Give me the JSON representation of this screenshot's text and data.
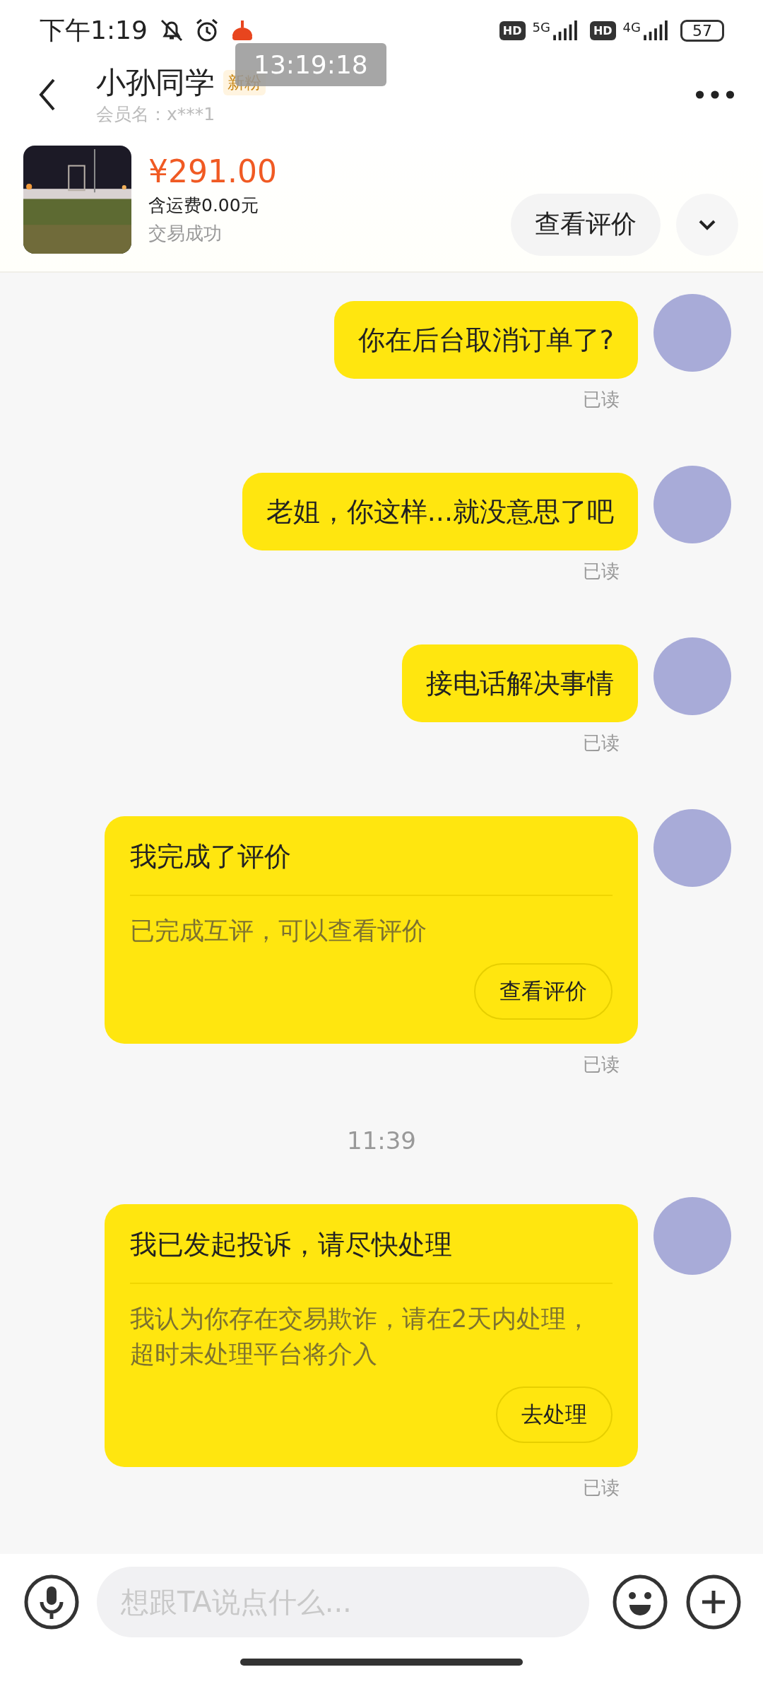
{
  "status_bar": {
    "time": "下午1:19",
    "networks": [
      {
        "hd": "HD",
        "type": "5G"
      },
      {
        "hd": "HD",
        "type": "4G"
      }
    ],
    "battery": "57"
  },
  "overlay_time": "13:19:18",
  "header": {
    "title": "小孙同学",
    "badge": "新粉",
    "subtitle": "会员名：x***1"
  },
  "product": {
    "price": "¥291.00",
    "shipping": "含运费0.00元",
    "status": "交易成功",
    "button": "查看评价"
  },
  "messages": [
    {
      "kind": "text",
      "text": "你在后台取消订单了?",
      "read": "已读"
    },
    {
      "kind": "text",
      "text": "老姐，你这样...就没意思了吧",
      "read": "已读"
    },
    {
      "kind": "text",
      "text": "接电话解决事情",
      "read": "已读"
    },
    {
      "kind": "card",
      "title": "我完成了评价",
      "body": "已完成互评，可以查看评价",
      "button": "查看评价",
      "read": "已读"
    },
    {
      "kind": "time",
      "text": "11:39"
    },
    {
      "kind": "card",
      "title": "我已发起投诉，请尽快处理",
      "body": "我认为你存在交易欺诈，请在2天内处理，超时未处理平台将介入",
      "button": "去处理",
      "read": "已读"
    }
  ],
  "input": {
    "placeholder": "想跟TA说点什么..."
  }
}
